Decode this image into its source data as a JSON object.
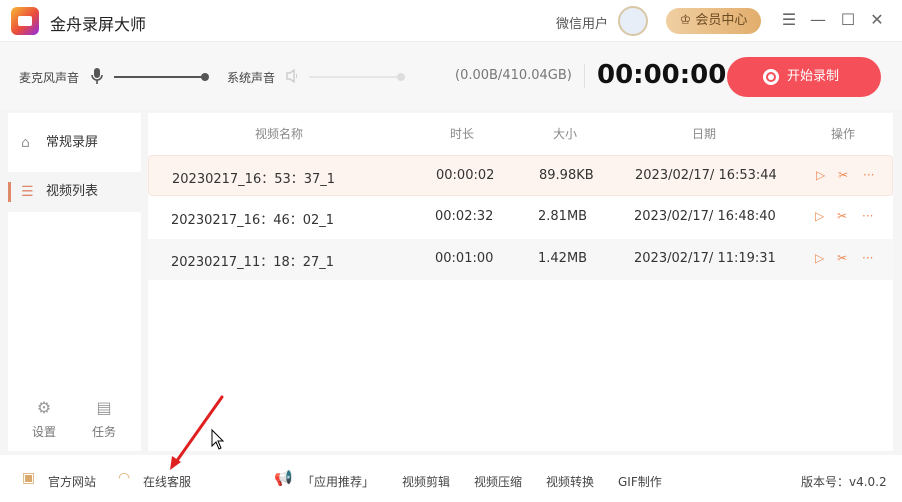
{
  "app": {
    "title": "金舟录屏大师",
    "user_name": "微信用户",
    "vip_label": "会员中心"
  },
  "window": {
    "menu": "☰",
    "minimize": "—",
    "maximize": "☐",
    "close": "✕"
  },
  "controls": {
    "mic_label": "麦克风声音",
    "mic_level": 1.0,
    "system_label": "系统声音",
    "system_level": 1.0,
    "system_muted": true,
    "storage": "(0.00B/410.04GB)",
    "timer": "00:00:00",
    "record_label": "开始录制"
  },
  "sidebar": {
    "items": [
      {
        "label": "常规录屏",
        "icon": "camera-icon"
      },
      {
        "label": "视频列表",
        "icon": "list-icon",
        "active": true
      }
    ],
    "settings": "设置",
    "tasks": "任务"
  },
  "table": {
    "headers": [
      "视频名称",
      "时长",
      "大小",
      "日期",
      "操作"
    ],
    "rows": [
      {
        "name": "20230217_16：53：37_1",
        "duration": "00:00:02",
        "size": "89.98KB",
        "date": "2023/02/17/ 16:53:44"
      },
      {
        "name": "20230217_16：46：02_1",
        "duration": "00:02:32",
        "size": "2.81MB",
        "date": "2023/02/17/ 16:48:40"
      },
      {
        "name": "20230217_11：18：27_1",
        "duration": "00:01:00",
        "size": "1.42MB",
        "date": "2023/02/17/ 11:19:31"
      }
    ]
  },
  "footer": {
    "website": "官方网站",
    "support": "在线客服",
    "recommend": "「应用推荐」",
    "links": [
      "视频剪辑",
      "视频压缩",
      "视频转换",
      "GIF制作"
    ],
    "version": "版本号：v4.0.2"
  },
  "colors": {
    "accent": "#f5505a",
    "highlight": "#fdf4ef",
    "action": "#ef8a55",
    "annotation": "#e02020"
  }
}
